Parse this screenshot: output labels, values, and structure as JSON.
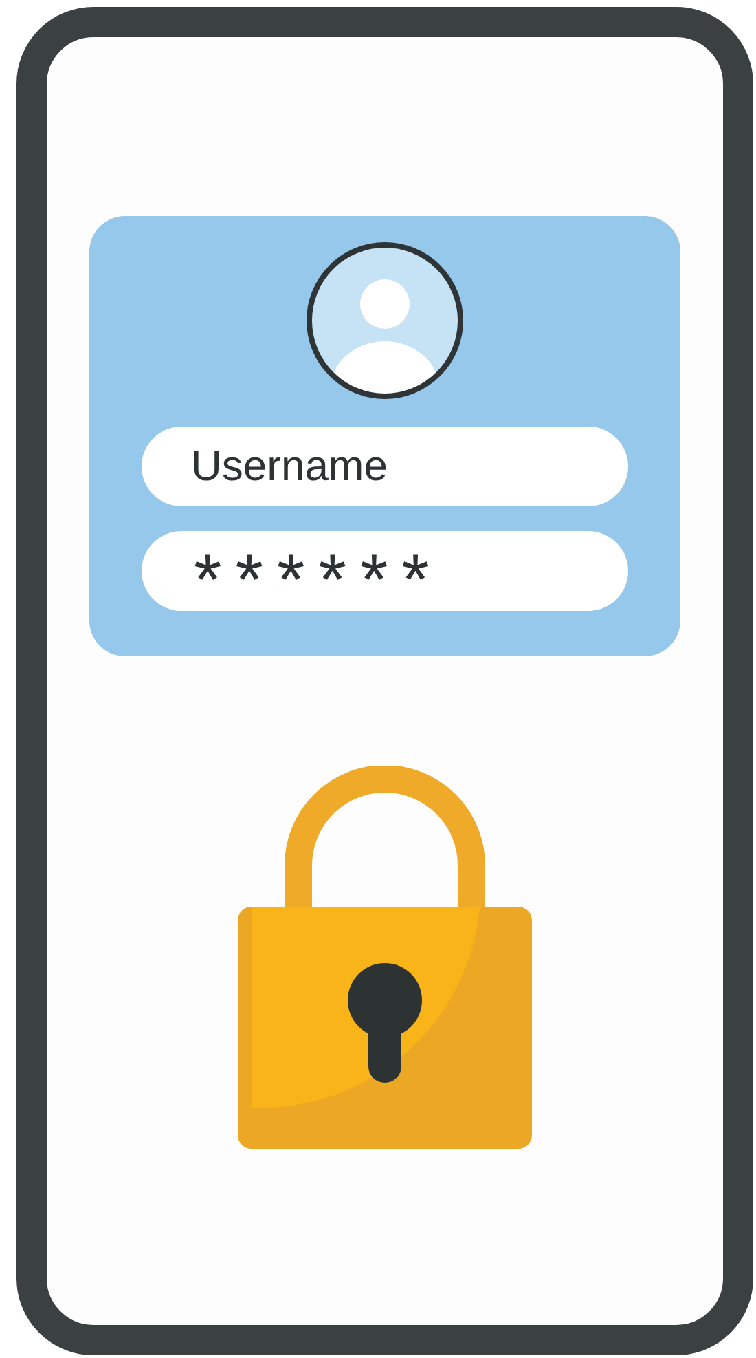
{
  "login_card": {
    "username_field": {
      "placeholder": "Username"
    },
    "password_field": {
      "value": "******"
    }
  }
}
